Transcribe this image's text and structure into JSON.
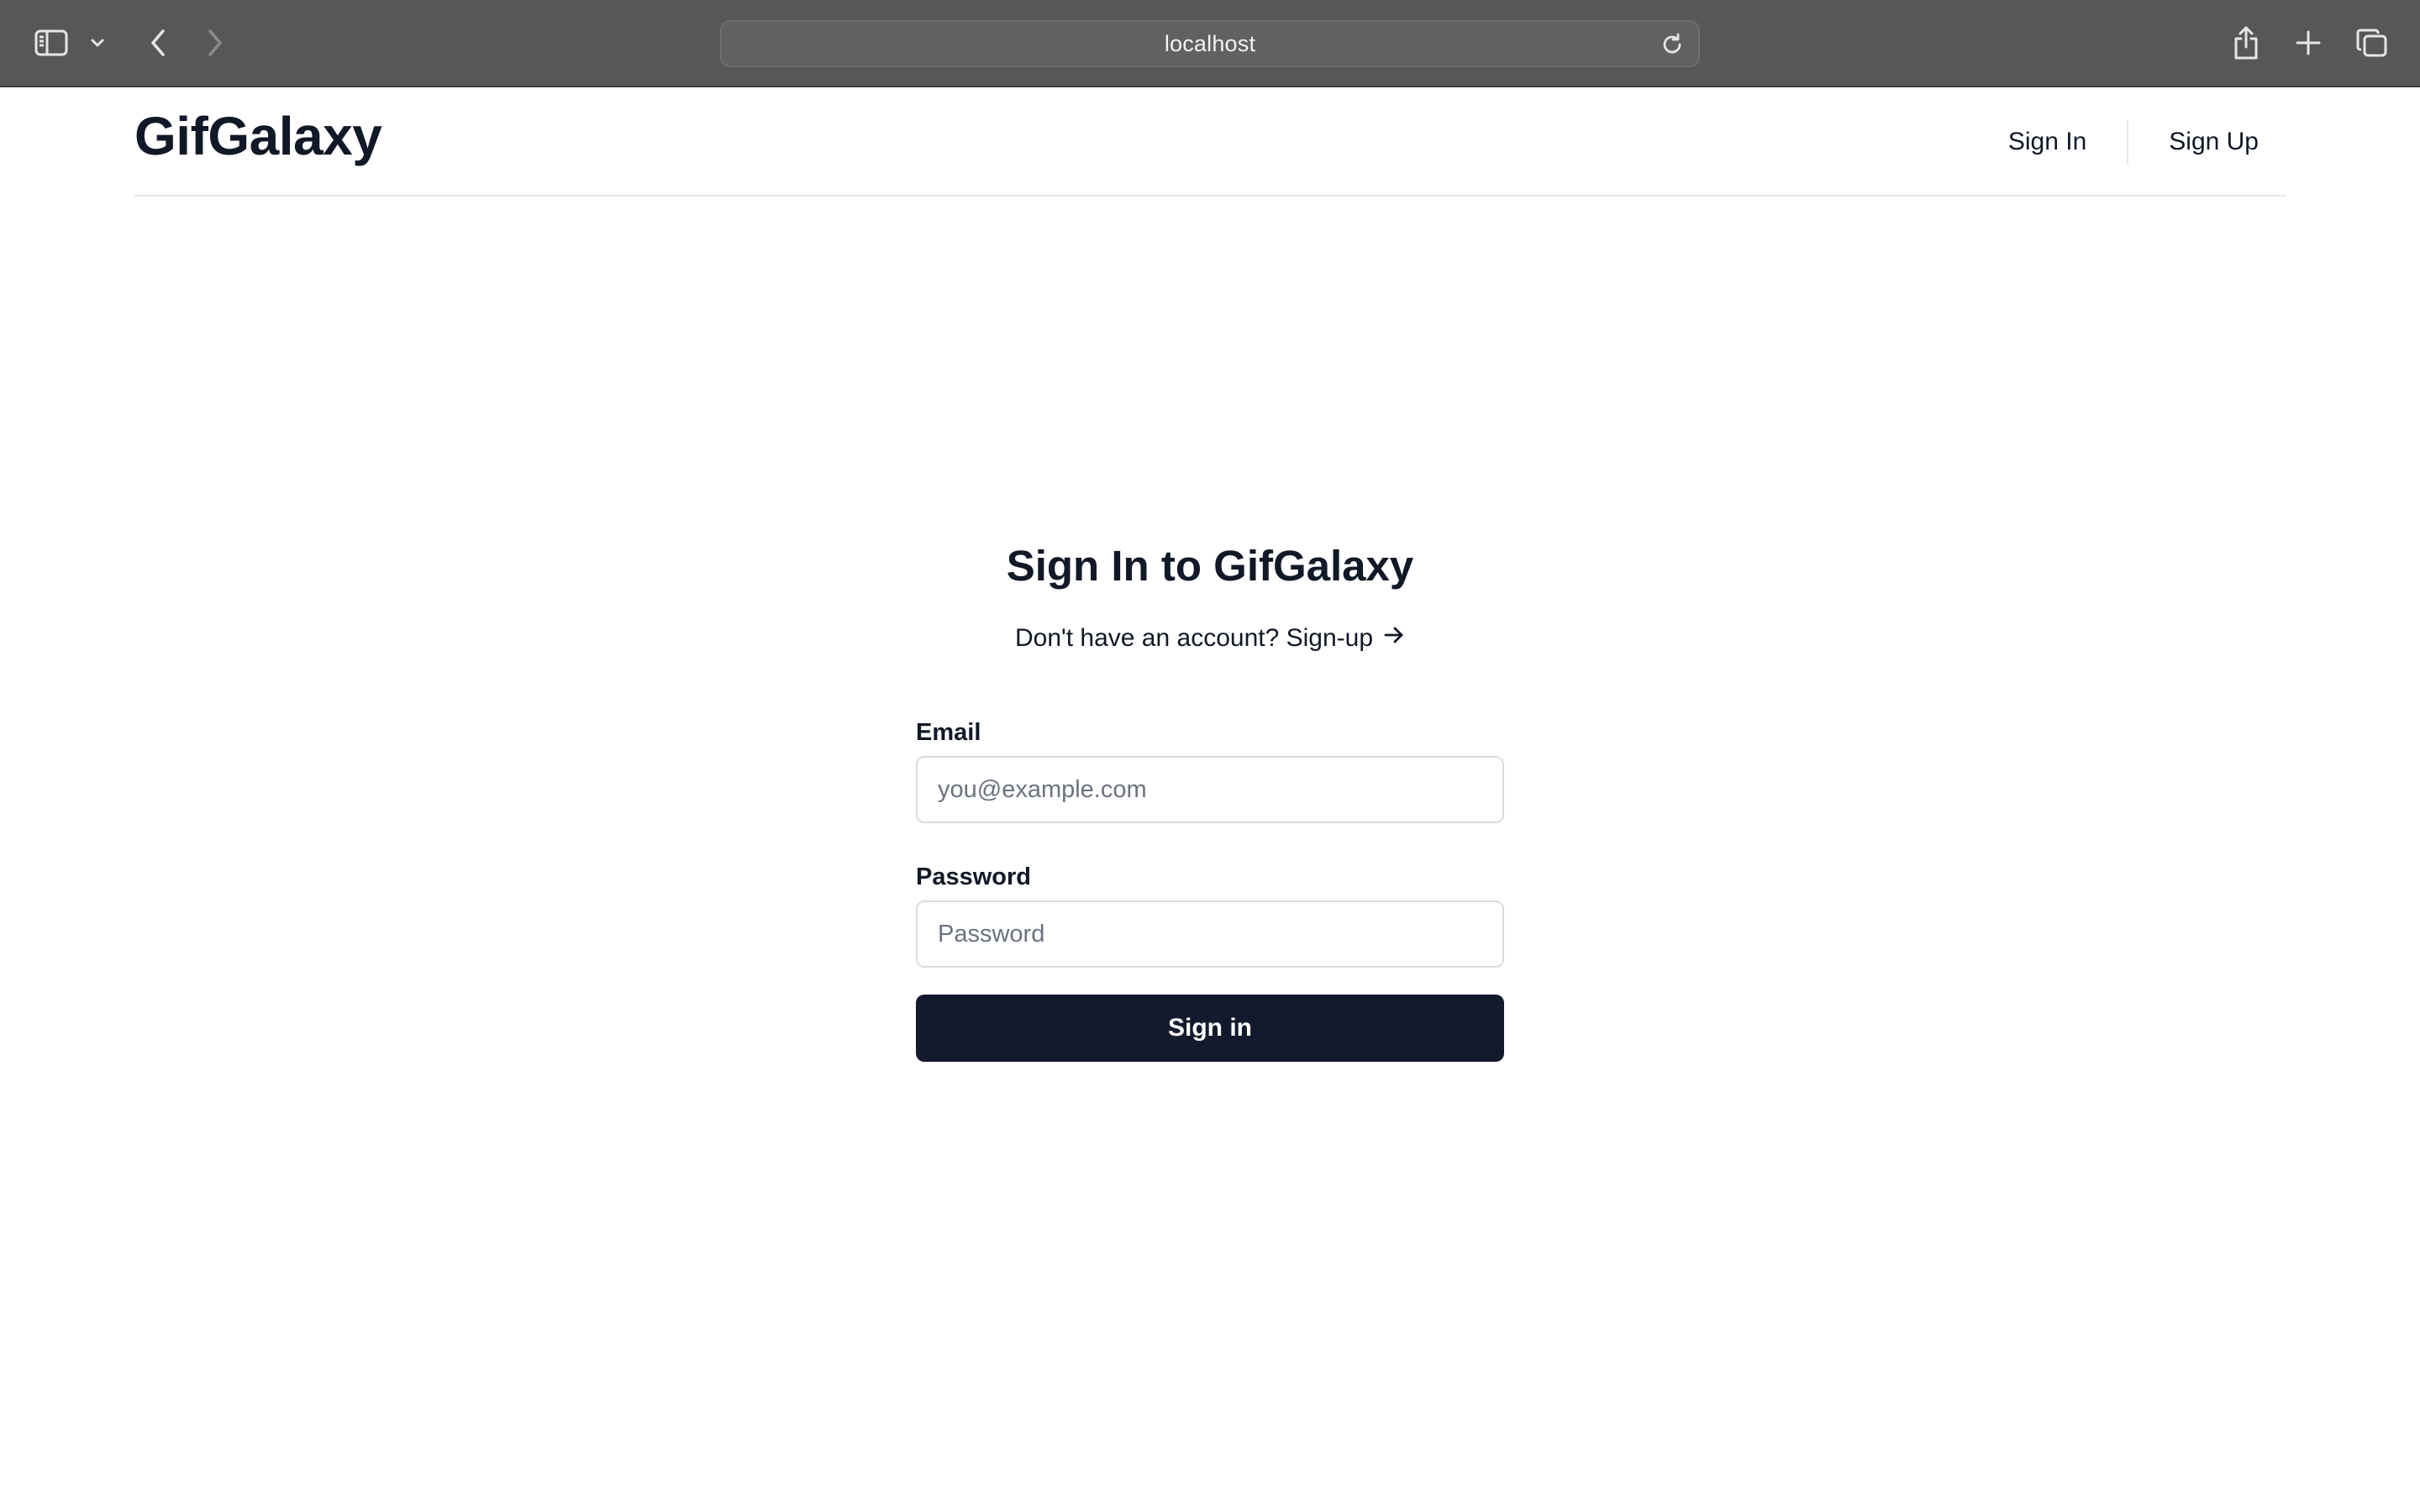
{
  "browser": {
    "address": "localhost",
    "icons": {
      "sidebar": "sidebar-icon",
      "dropdown": "chevron-down-icon",
      "back": "chevron-left-icon",
      "forward": "chevron-right-icon",
      "reload": "reload-icon",
      "share": "share-icon",
      "new_tab": "plus-icon",
      "tab_overview": "tabs-icon"
    }
  },
  "header": {
    "logo": "GifGalaxy",
    "nav": {
      "sign_in": "Sign In",
      "sign_up": "Sign Up"
    }
  },
  "signin": {
    "title": "Sign In to GifGalaxy",
    "prompt_text": "Don't have an account? Sign-up",
    "prompt_icon": "arrow-right-icon",
    "email": {
      "label": "Email",
      "placeholder": "you@example.com",
      "value": ""
    },
    "password": {
      "label": "Password",
      "placeholder": "Password",
      "value": ""
    },
    "submit_label": "Sign in"
  },
  "colors": {
    "browser_chrome": "#555857",
    "primary_button": "#141a2e",
    "text": "#111827",
    "border": "#e5e7eb"
  }
}
